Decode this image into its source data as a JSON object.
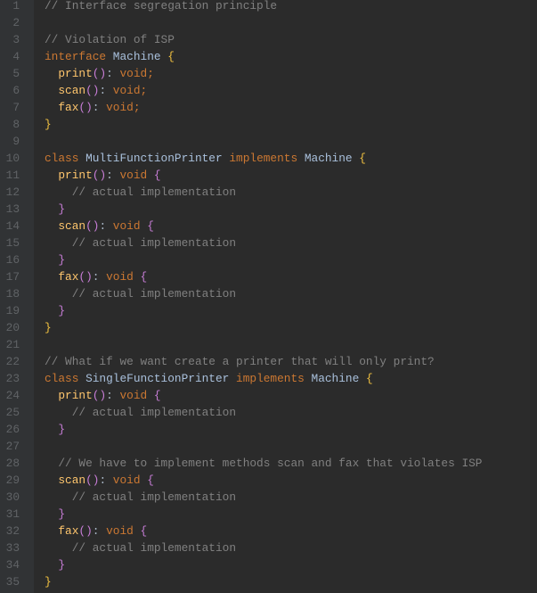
{
  "editor": {
    "lines": [
      [
        [
          "cm",
          "// Interface segregation principle"
        ]
      ],
      [],
      [
        [
          "cm",
          "// Violation of ISP"
        ]
      ],
      [
        [
          "kw",
          "interface "
        ],
        [
          "cls",
          "Machine "
        ],
        [
          "b0",
          "{"
        ]
      ],
      [
        [
          "pu",
          "  "
        ],
        [
          "fn",
          "print"
        ],
        [
          "pa",
          "()"
        ],
        [
          "pu",
          ": "
        ],
        [
          "ty",
          "void"
        ],
        [
          "kw",
          ";"
        ]
      ],
      [
        [
          "pu",
          "  "
        ],
        [
          "fn",
          "scan"
        ],
        [
          "pa",
          "()"
        ],
        [
          "pu",
          ": "
        ],
        [
          "ty",
          "void"
        ],
        [
          "kw",
          ";"
        ]
      ],
      [
        [
          "pu",
          "  "
        ],
        [
          "fn",
          "fax"
        ],
        [
          "pa",
          "()"
        ],
        [
          "pu",
          ": "
        ],
        [
          "ty",
          "void"
        ],
        [
          "kw",
          ";"
        ]
      ],
      [
        [
          "b0",
          "}"
        ]
      ],
      [],
      [
        [
          "kw",
          "class "
        ],
        [
          "cls",
          "MultiFunctionPrinter "
        ],
        [
          "kw",
          "implements "
        ],
        [
          "cls",
          "Machine "
        ],
        [
          "b0",
          "{"
        ]
      ],
      [
        [
          "pu",
          "  "
        ],
        [
          "fn",
          "print"
        ],
        [
          "pa",
          "()"
        ],
        [
          "pu",
          ": "
        ],
        [
          "ty",
          "void "
        ],
        [
          "b1",
          "{"
        ]
      ],
      [
        [
          "pu",
          "    "
        ],
        [
          "cm",
          "// actual implementation"
        ]
      ],
      [
        [
          "pu",
          "  "
        ],
        [
          "b1",
          "}"
        ]
      ],
      [
        [
          "pu",
          "  "
        ],
        [
          "fn",
          "scan"
        ],
        [
          "pa",
          "()"
        ],
        [
          "pu",
          ": "
        ],
        [
          "ty",
          "void "
        ],
        [
          "b1",
          "{"
        ]
      ],
      [
        [
          "pu",
          "    "
        ],
        [
          "cm",
          "// actual implementation"
        ]
      ],
      [
        [
          "pu",
          "  "
        ],
        [
          "b1",
          "}"
        ]
      ],
      [
        [
          "pu",
          "  "
        ],
        [
          "fn",
          "fax"
        ],
        [
          "pa",
          "()"
        ],
        [
          "pu",
          ": "
        ],
        [
          "ty",
          "void "
        ],
        [
          "b1",
          "{"
        ]
      ],
      [
        [
          "pu",
          "    "
        ],
        [
          "cm",
          "// actual implementation"
        ]
      ],
      [
        [
          "pu",
          "  "
        ],
        [
          "b1",
          "}"
        ]
      ],
      [
        [
          "b0",
          "}"
        ]
      ],
      [],
      [
        [
          "cm",
          "// What if we want create a printer that will only print?"
        ]
      ],
      [
        [
          "kw",
          "class "
        ],
        [
          "cls",
          "SingleFunctionPrinter "
        ],
        [
          "kw",
          "implements "
        ],
        [
          "cls",
          "Machine "
        ],
        [
          "b0",
          "{"
        ]
      ],
      [
        [
          "pu",
          "  "
        ],
        [
          "fn",
          "print"
        ],
        [
          "pa",
          "()"
        ],
        [
          "pu",
          ": "
        ],
        [
          "ty",
          "void "
        ],
        [
          "b1",
          "{"
        ]
      ],
      [
        [
          "pu",
          "    "
        ],
        [
          "cm",
          "// actual implementation"
        ]
      ],
      [
        [
          "pu",
          "  "
        ],
        [
          "b1",
          "}"
        ]
      ],
      [],
      [
        [
          "pu",
          "  "
        ],
        [
          "cm",
          "// We have to implement methods scan and fax that violates ISP"
        ]
      ],
      [
        [
          "pu",
          "  "
        ],
        [
          "fn",
          "scan"
        ],
        [
          "pa",
          "()"
        ],
        [
          "pu",
          ": "
        ],
        [
          "ty",
          "void "
        ],
        [
          "b1",
          "{"
        ]
      ],
      [
        [
          "pu",
          "    "
        ],
        [
          "cm",
          "// actual implementation"
        ]
      ],
      [
        [
          "pu",
          "  "
        ],
        [
          "b1",
          "}"
        ]
      ],
      [
        [
          "pu",
          "  "
        ],
        [
          "fn",
          "fax"
        ],
        [
          "pa",
          "()"
        ],
        [
          "pu",
          ": "
        ],
        [
          "ty",
          "void "
        ],
        [
          "b1",
          "{"
        ]
      ],
      [
        [
          "pu",
          "    "
        ],
        [
          "cm",
          "// actual implementation"
        ]
      ],
      [
        [
          "pu",
          "  "
        ],
        [
          "b1",
          "}"
        ]
      ],
      [
        [
          "b0",
          "}"
        ]
      ]
    ]
  }
}
